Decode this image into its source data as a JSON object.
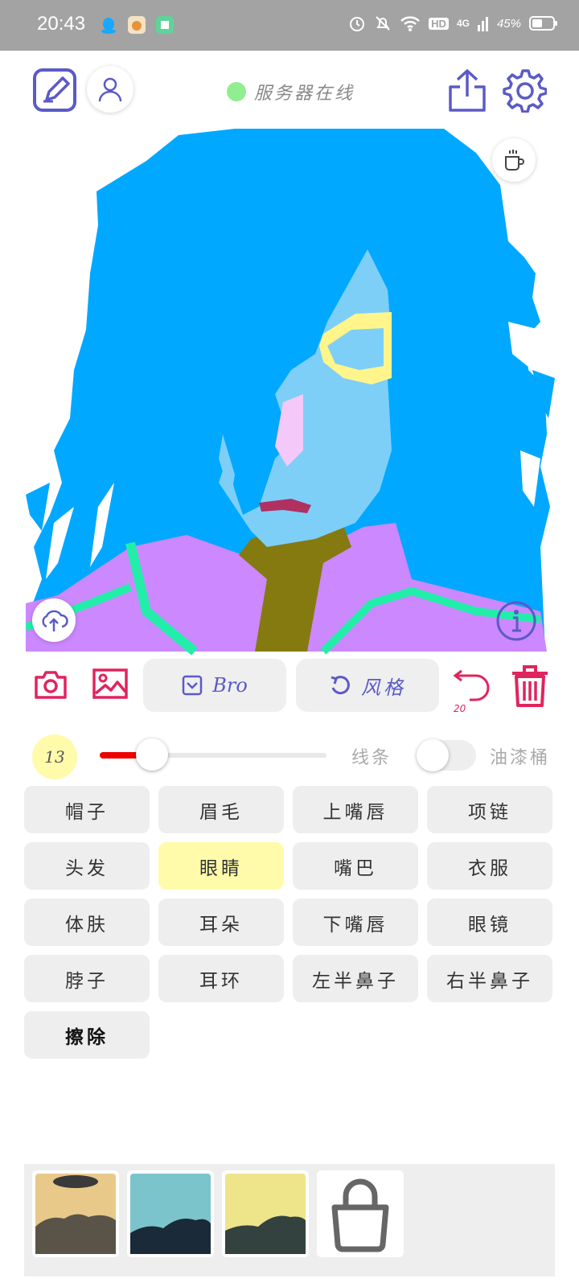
{
  "status_bar": {
    "time": "20:43",
    "network": "4G",
    "hd": "HD",
    "battery": "45%"
  },
  "header": {
    "server_status": "服务器在线",
    "status_color": "#90ee90"
  },
  "toolbar": {
    "model_label": "Bro",
    "style_label": "风格",
    "undo_count": "20"
  },
  "brush": {
    "size": "13",
    "size_level": 0.23,
    "mode_line": "线条",
    "mode_bucket": "油漆桶",
    "bucket_enabled": false
  },
  "parts": [
    {
      "label": "帽子",
      "active": false
    },
    {
      "label": "眉毛",
      "active": false
    },
    {
      "label": "上嘴唇",
      "active": false
    },
    {
      "label": "项链",
      "active": false
    },
    {
      "label": "头发",
      "active": false
    },
    {
      "label": "眼睛",
      "active": true
    },
    {
      "label": "嘴巴",
      "active": false
    },
    {
      "label": "衣服",
      "active": false
    },
    {
      "label": "体肤",
      "active": false
    },
    {
      "label": "耳朵",
      "active": false
    },
    {
      "label": "下嘴唇",
      "active": false
    },
    {
      "label": "眼镜",
      "active": false
    },
    {
      "label": "脖子",
      "active": false
    },
    {
      "label": "耳环",
      "active": false
    },
    {
      "label": "左半鼻子",
      "active": false
    },
    {
      "label": "右半鼻子",
      "active": false
    },
    {
      "label": "擦除",
      "active": false
    }
  ],
  "colors": {
    "accent_purple": "#5a5ac8",
    "accent_red": "#e0245e",
    "hair_blue": "#00a8ff",
    "skin_blue": "#7dcff8",
    "clothes_purple": "#cc88ff",
    "neck_olive": "#857a10",
    "trim_green": "#22eeaa",
    "eye_yellow": "#fff58a"
  },
  "icons": [
    "edit-icon",
    "user-icon",
    "share-icon",
    "settings-icon",
    "coffee-icon",
    "upload-icon",
    "info-icon",
    "camera-icon",
    "image-icon",
    "checkbox-icon",
    "redo-icon",
    "undo-icon",
    "trash-icon",
    "lock-icon"
  ]
}
